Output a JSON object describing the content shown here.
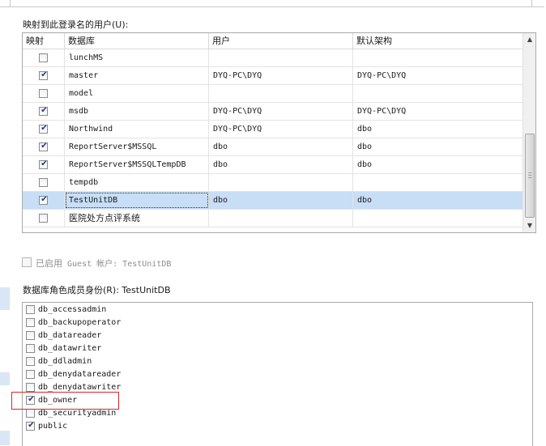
{
  "mapped_users_label": "映射到此登录名的用户(U):",
  "grid": {
    "columns": [
      "映射",
      "数据库",
      "用户",
      "默认架构"
    ],
    "rows": [
      {
        "checked": false,
        "database": "lunchMS",
        "user": "",
        "schema": "",
        "ellipsis": false,
        "selected": false
      },
      {
        "checked": true,
        "database": "master",
        "user": "DYQ-PC\\DYQ",
        "schema": "DYQ-PC\\DYQ",
        "ellipsis": true,
        "selected": false
      },
      {
        "checked": false,
        "database": "model",
        "user": "",
        "schema": "",
        "ellipsis": false,
        "selected": false
      },
      {
        "checked": true,
        "database": "msdb",
        "user": "DYQ-PC\\DYQ",
        "schema": "DYQ-PC\\DYQ",
        "ellipsis": true,
        "selected": false
      },
      {
        "checked": true,
        "database": "Northwind",
        "user": "DYQ-PC\\DYQ",
        "schema": "dbo",
        "ellipsis": true,
        "selected": false
      },
      {
        "checked": true,
        "database": "ReportServer$MSSQL",
        "user": "dbo",
        "schema": "dbo",
        "ellipsis": true,
        "selected": false
      },
      {
        "checked": true,
        "database": "ReportServer$MSSQLTempDB",
        "user": "dbo",
        "schema": "dbo",
        "ellipsis": true,
        "selected": false
      },
      {
        "checked": false,
        "database": "tempdb",
        "user": "",
        "schema": "",
        "ellipsis": false,
        "selected": false
      },
      {
        "checked": true,
        "database": "TestUnitDB",
        "user": "dbo",
        "schema": "dbo",
        "ellipsis": true,
        "selected": true
      },
      {
        "checked": false,
        "database": "医院处方点评系统",
        "user": "",
        "schema": "",
        "ellipsis": false,
        "selected": false
      }
    ],
    "ellipsis_label": "...",
    "scroll_up": "▲",
    "scroll_down": "▼"
  },
  "guest": {
    "prefix": "已启用",
    "text": " Guest 帐户: TestUnitDB",
    "checked": false,
    "enabled": false
  },
  "roles_label": "数据库角色成员身份(R): TestUnitDB",
  "roles": [
    {
      "name": "db_accessadmin",
      "checked": false
    },
    {
      "name": "db_backupoperator",
      "checked": false
    },
    {
      "name": "db_datareader",
      "checked": false
    },
    {
      "name": "db_datawriter",
      "checked": false
    },
    {
      "name": "db_ddladmin",
      "checked": false
    },
    {
      "name": "db_denydatareader",
      "checked": false
    },
    {
      "name": "db_denydatawriter",
      "checked": false
    },
    {
      "name": "db_owner",
      "checked": true,
      "highlighted": true
    },
    {
      "name": "db_securityadmin",
      "checked": false
    },
    {
      "name": "public",
      "checked": true
    }
  ],
  "colors": {
    "selection": "#c7def6",
    "highlight_border": "#d9262b",
    "check": "#1c3c8c"
  }
}
